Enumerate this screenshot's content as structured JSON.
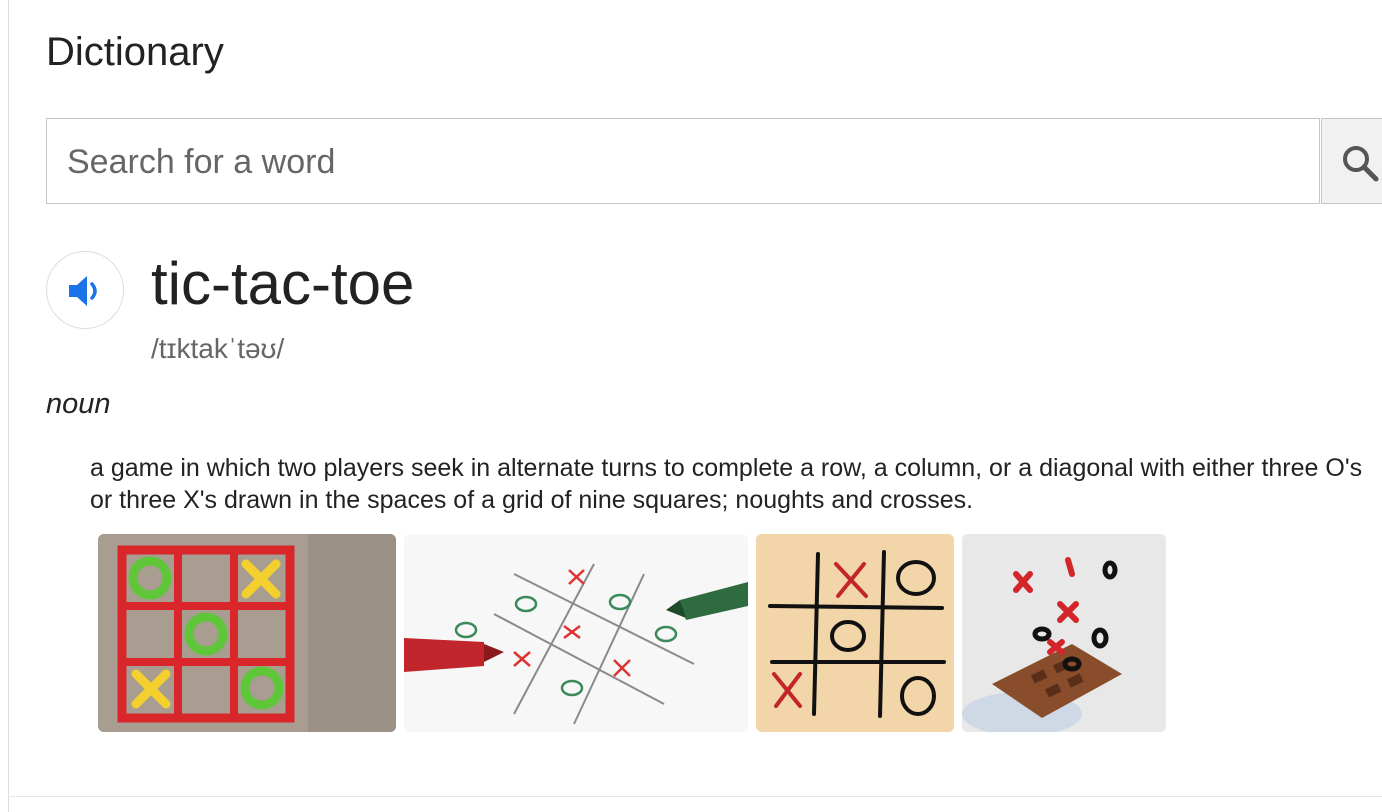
{
  "header": {
    "title": "Dictionary"
  },
  "search": {
    "placeholder": "Search for a word",
    "value": ""
  },
  "entry": {
    "word": "tic-tac-toe",
    "phonetic": "/tɪktakˈtəʊ/",
    "part_of_speech": "noun",
    "definition": "a game in which two players seek in alternate turns to complete a row, a column, or a diagonal with either three O's or three X's drawn in the spaces of a grid of nine squares; noughts and crosses."
  },
  "icons": {
    "search": "search-icon",
    "audio": "speaker-icon"
  },
  "colors": {
    "accent": "#1a73e8",
    "border": "#c6c6c6"
  }
}
